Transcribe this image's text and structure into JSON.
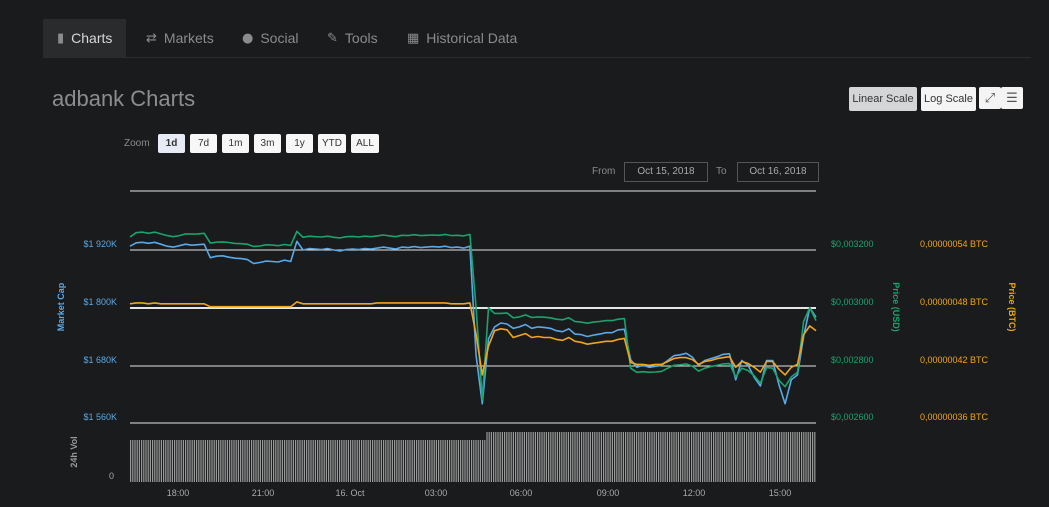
{
  "tabs": [
    {
      "label": "Charts",
      "icon": "bar-chart-icon",
      "active": true
    },
    {
      "label": "Markets",
      "icon": "exchange-icon"
    },
    {
      "label": "Social",
      "icon": "globe-icon"
    },
    {
      "label": "Tools",
      "icon": "wrench-icon"
    },
    {
      "label": "Historical Data",
      "icon": "calendar-icon"
    }
  ],
  "title": "adbank Charts",
  "scale_buttons": {
    "linear": "Linear Scale",
    "log": "Log Scale"
  },
  "zoom": {
    "label": "Zoom",
    "options": [
      "1d",
      "7d",
      "1m",
      "3m",
      "1y",
      "YTD",
      "ALL"
    ],
    "selected": "1d"
  },
  "range": {
    "from_label": "From",
    "from": "Oct 15, 2018",
    "to_label": "To",
    "to": "Oct 16, 2018"
  },
  "colors": {
    "market_cap": "#5aa9e6",
    "price_usd": "#1aa36b",
    "price_btc": "#f0a51a",
    "volume": "#9a9a9a",
    "grid": "#e6e6e6"
  },
  "chart_data": {
    "type": "line",
    "x_ticks": [
      "18:00",
      "21:00",
      "16. Oct",
      "03:00",
      "06:00",
      "09:00",
      "12:00",
      "15:00"
    ],
    "axes": {
      "market_cap": {
        "title": "Market Cap",
        "ticks": [
          "$1 920K",
          "$1 800K",
          "$1 680K",
          "$1 560K"
        ],
        "range": [
          1560,
          1920
        ]
      },
      "price_usd": {
        "title": "Price (USD)",
        "ticks": [
          "$0,003200",
          "$0,003000",
          "$0,002800",
          "$0,002600"
        ],
        "range": [
          0.0026,
          0.0032
        ]
      },
      "price_btc": {
        "title": "Price (BTC)",
        "ticks": [
          "0,00000054 BTC",
          "0,00000048 BTC",
          "0,00000042 BTC",
          "0,00000036 BTC"
        ],
        "range": [
          3.6e-07,
          5.4e-07
        ]
      },
      "volume": {
        "title": "24h Vol",
        "ticks": [
          "0"
        ]
      }
    },
    "series": [
      {
        "name": "Market Cap",
        "values": [
          1928,
          1935,
          1936,
          1934,
          1936,
          1932,
          1928,
          1926,
          1929,
          1932,
          1930,
          1931,
          1932,
          1904,
          1907,
          1908,
          1905,
          1903,
          1902,
          1900,
          1892,
          1894,
          1897,
          1896,
          1895,
          1899,
          1896,
          1938,
          1920,
          1923,
          1922,
          1921,
          1923,
          1920,
          1918,
          1921,
          1922,
          1921,
          1923,
          1922,
          1924,
          1926,
          1924,
          1922,
          1926,
          1925,
          1927,
          1925,
          1926,
          1927,
          1926,
          1928,
          1925,
          1926,
          1924,
          1928,
          1700,
          1600,
          1735,
          1760,
          1768,
          1766,
          1757,
          1760,
          1765,
          1757,
          1760,
          1759,
          1757,
          1752,
          1750,
          1756,
          1745,
          1744,
          1740,
          1743,
          1745,
          1748,
          1748,
          1754,
          1755,
          1692,
          1676,
          1680,
          1676,
          1678,
          1680,
          1690,
          1700,
          1702,
          1705,
          1697,
          1680,
          1690,
          1694,
          1698,
          1703,
          1704,
          1650,
          1690,
          1680,
          1655,
          1637,
          1690,
          1690,
          1640,
          1600,
          1650,
          1660,
          1740,
          1800,
          1780
        ]
      },
      {
        "name": "Price (USD)",
        "values": [
          0.003245,
          0.00326,
          0.003262,
          0.003258,
          0.003262,
          0.003256,
          0.00325,
          0.003246,
          0.00325,
          0.003256,
          0.003255,
          0.003256,
          0.003258,
          0.003224,
          0.003227,
          0.003228,
          0.003226,
          0.003223,
          0.003222,
          0.00322,
          0.003212,
          0.003214,
          0.003218,
          0.003217,
          0.003215,
          0.003219,
          0.003216,
          0.003265,
          0.003244,
          0.003248,
          0.003246,
          0.003245,
          0.003248,
          0.003244,
          0.003242,
          0.003246,
          0.003247,
          0.003245,
          0.003248,
          0.003246,
          0.003249,
          0.003252,
          0.003249,
          0.003246,
          0.003251,
          0.00325,
          0.003253,
          0.00325,
          0.003251,
          0.003252,
          0.003251,
          0.003254,
          0.00325,
          0.003251,
          0.003249,
          0.003254,
          0.003,
          0.00268,
          0.003,
          0.00298,
          0.00298,
          0.002982,
          0.002965,
          0.002968,
          0.002975,
          0.002966,
          0.002968,
          0.002967,
          0.002965,
          0.00296,
          0.002958,
          0.002965,
          0.002952,
          0.00295,
          0.002946,
          0.00295,
          0.002952,
          0.002955,
          0.002955,
          0.00296,
          0.002962,
          0.00279,
          0.002776,
          0.002778,
          0.002776,
          0.002777,
          0.002779,
          0.00279,
          0.0028,
          0.002802,
          0.002805,
          0.002797,
          0.00278,
          0.00279,
          0.002796,
          0.0028,
          0.002805,
          0.002806,
          0.00276,
          0.00279,
          0.002782,
          0.002764,
          0.002738,
          0.002792,
          0.00279,
          0.002748,
          0.002726,
          0.00276,
          0.002776,
          0.002952,
          0.003,
          0.002955
        ]
      },
      {
        "name": "Price (BTC)",
        "values": [
          4.84e-07,
          4.85e-07,
          4.85e-07,
          4.84e-07,
          4.85e-07,
          4.84e-07,
          4.84e-07,
          4.84e-07,
          4.84e-07,
          4.84e-07,
          4.84e-07,
          4.84e-07,
          4.84e-07,
          4.81e-07,
          4.81e-07,
          4.81e-07,
          4.81e-07,
          4.81e-07,
          4.81e-07,
          4.81e-07,
          4.81e-07,
          4.81e-07,
          4.81e-07,
          4.81e-07,
          4.81e-07,
          4.81e-07,
          4.81e-07,
          4.86e-07,
          4.84e-07,
          4.84e-07,
          4.84e-07,
          4.84e-07,
          4.84e-07,
          4.84e-07,
          4.84e-07,
          4.84e-07,
          4.84e-07,
          4.84e-07,
          4.84e-07,
          4.84e-07,
          4.85e-07,
          4.85e-07,
          4.85e-07,
          4.85e-07,
          4.85e-07,
          4.85e-07,
          4.85e-07,
          4.85e-07,
          4.85e-07,
          4.85e-07,
          4.85e-07,
          4.85e-07,
          4.84e-07,
          4.84e-07,
          4.84e-07,
          4.85e-07,
          4.52e-07,
          4.1e-07,
          4.4e-07,
          4.56e-07,
          4.58e-07,
          4.57e-07,
          4.49e-07,
          4.51e-07,
          4.53e-07,
          4.49e-07,
          4.5e-07,
          4.49e-07,
          4.49e-07,
          4.47e-07,
          4.46e-07,
          4.49e-07,
          4.45e-07,
          4.44e-07,
          4.42e-07,
          4.43e-07,
          4.44e-07,
          4.45e-07,
          4.45e-07,
          4.47e-07,
          4.48e-07,
          4.23e-07,
          4.21e-07,
          4.21e-07,
          4.2e-07,
          4.21e-07,
          4.21e-07,
          4.24e-07,
          4.27e-07,
          4.28e-07,
          4.28e-07,
          4.26e-07,
          4.21e-07,
          4.24e-07,
          4.25e-07,
          4.27e-07,
          4.28e-07,
          4.29e-07,
          4.18e-07,
          4.24e-07,
          4.22e-07,
          4.18e-07,
          4.13e-07,
          4.24e-07,
          4.24e-07,
          4.16e-07,
          4.1e-07,
          4.18e-07,
          4.21e-07,
          4.52e-07,
          4.61e-07,
          4.56e-07
        ]
      }
    ]
  }
}
